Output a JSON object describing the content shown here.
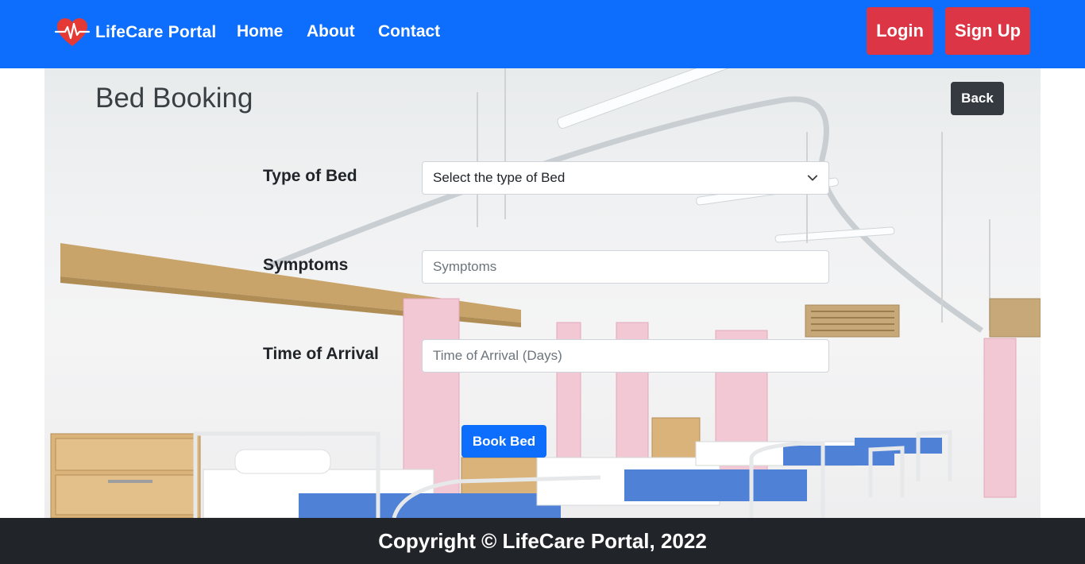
{
  "navbar": {
    "brand": "LifeCare Portal",
    "links": {
      "home": "Home",
      "about": "About",
      "contact": "Contact"
    },
    "login": "Login",
    "signup": "Sign Up"
  },
  "page": {
    "title": "Bed Booking",
    "back": "Back"
  },
  "form": {
    "type_label": "Type of Bed",
    "type_selected": "Select the type of Bed",
    "symptoms_label": "Symptoms",
    "symptoms_placeholder": "Symptoms",
    "time_label": "Time of Arrival",
    "time_placeholder": "Time of Arrival (Days)",
    "submit": "Book Bed"
  },
  "footer": {
    "copyright": "Copyright © LifeCare Portal, 2022"
  },
  "colors": {
    "primary": "#0d6efd",
    "danger": "#dc3545",
    "dark": "#343a40",
    "footer": "#212529"
  },
  "icons": {
    "logo": "heart-pulse-icon",
    "select": "chevron-down-icon"
  }
}
